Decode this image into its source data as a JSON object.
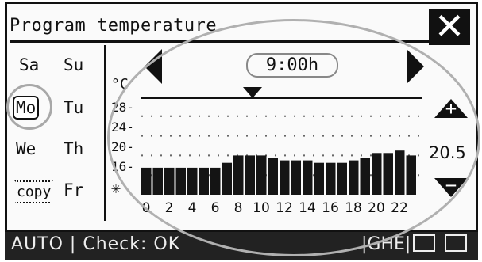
{
  "header": {
    "title": "Program temperature",
    "close_label": "✕"
  },
  "days": {
    "row1": [
      "Sa",
      "Su"
    ],
    "row2": [
      "Mo",
      "Tu"
    ],
    "row3": [
      "We",
      "Th"
    ],
    "row4": [
      "copy",
      "Fr"
    ],
    "selected": "Mo"
  },
  "chart": {
    "time_label": "9:00h",
    "unit": "°C",
    "y_ticks": [
      "28-",
      "24-",
      "20-",
      "16-"
    ],
    "frost_symbol": "✳"
  },
  "temperature": {
    "value": "20.5",
    "up_icon": "plus-arrow-icon",
    "down_icon": "minus-arrow-icon"
  },
  "status": {
    "mode": "AUTO",
    "separator": "|",
    "check": "Check: OK",
    "code": "|GHE|"
  },
  "chart_data": {
    "type": "bar",
    "categories": [
      "0",
      "1",
      "2",
      "3",
      "4",
      "5",
      "6",
      "7",
      "8",
      "9",
      "10",
      "11",
      "12",
      "13",
      "14",
      "15",
      "16",
      "17",
      "18",
      "19",
      "20",
      "21",
      "22",
      "23"
    ],
    "x_tick_labels": [
      "0",
      "2",
      "4",
      "6",
      "8",
      "10",
      "12",
      "14",
      "16",
      "18",
      "20",
      "22"
    ],
    "values": [
      17.5,
      17.5,
      17.5,
      17.5,
      17.5,
      17.5,
      17.5,
      18.5,
      20,
      20,
      20,
      19.5,
      19,
      19,
      19,
      18.5,
      18.5,
      18.5,
      19,
      19.5,
      20.5,
      20.5,
      21,
      20
    ],
    "ylim": [
      12,
      30
    ],
    "y_tick_values": [
      28,
      24,
      20,
      16
    ],
    "ylabel": "°C",
    "grid": true
  }
}
